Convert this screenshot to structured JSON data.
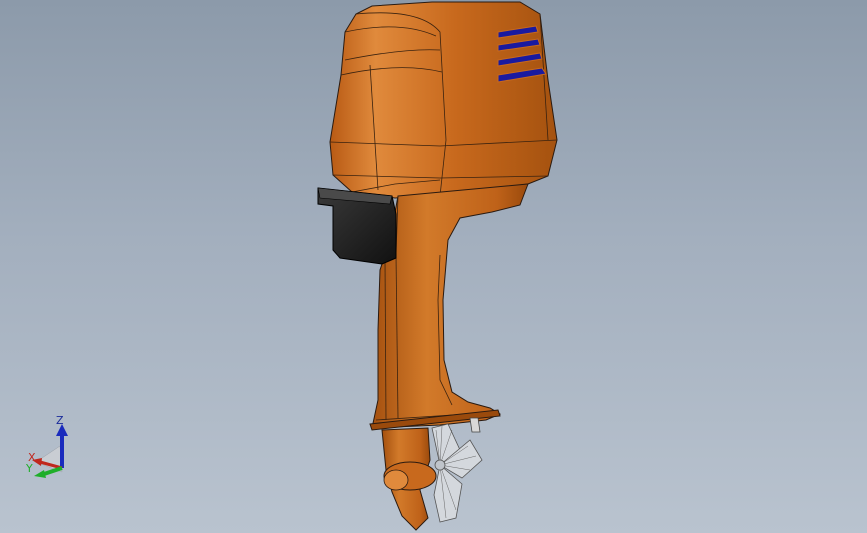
{
  "viewport": {
    "background_top": "#8c9aaa",
    "background_bottom": "#b9c3cf"
  },
  "model": {
    "cowling_color": "#c8691d",
    "vent_color": "#1a1aa0",
    "handle_color": "#1c1c1c",
    "propeller_color": "#cfd3d8"
  },
  "triad": {
    "z_label": "Z",
    "x_label": "X",
    "y_label": "Y",
    "z_color": "#1a2bbd",
    "x_color": "#c0281e",
    "y_color": "#1fae2a"
  }
}
